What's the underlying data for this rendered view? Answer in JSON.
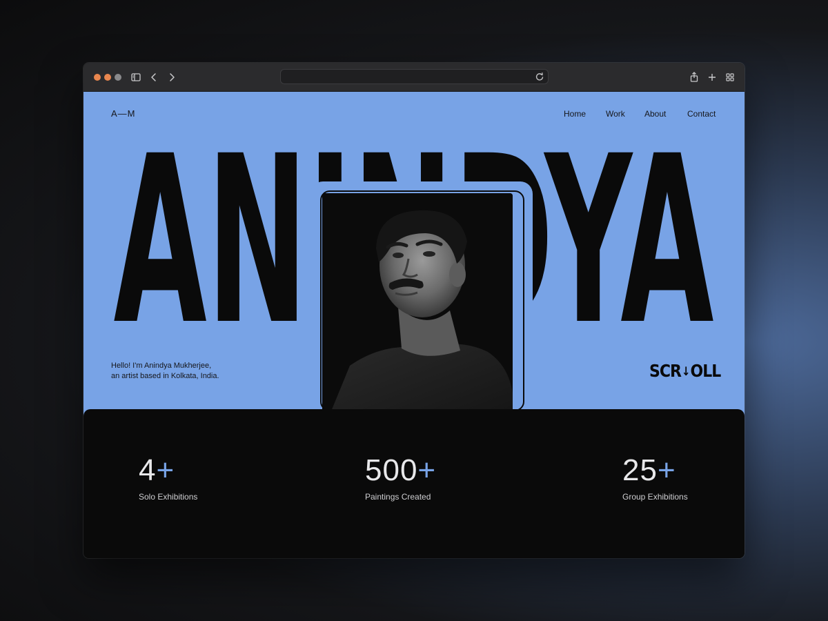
{
  "browser": {
    "url": "",
    "icons": [
      "sidebar-icon",
      "back-icon",
      "forward-icon",
      "reload-icon",
      "share-icon",
      "new-tab-icon",
      "tab-overview-icon"
    ]
  },
  "header": {
    "logo": "A—M",
    "nav": [
      "Home",
      "Work",
      "About",
      "Contact"
    ]
  },
  "hero": {
    "name": "ANINDYA",
    "intro_line1": "Hello! I'm Anindya Mukherjee,",
    "intro_line2": "an artist based in Kolkata, India.",
    "scroll_left": "SCR",
    "scroll_arrow": "↓",
    "scroll_right": "OLL"
  },
  "stats": [
    {
      "value": "4",
      "suffix": "+",
      "label": "Solo Exhibitions"
    },
    {
      "value": "500",
      "suffix": "+",
      "label": "Paintings Created"
    },
    {
      "value": "25",
      "suffix": "+",
      "label": "Group Exhibitions"
    }
  ],
  "colors": {
    "accent": "#78a3e6",
    "dark": "#0a0a0a",
    "traffic_close": "#e9874f",
    "traffic_min": "#e9874f",
    "traffic_max": "#8a8a8c"
  }
}
